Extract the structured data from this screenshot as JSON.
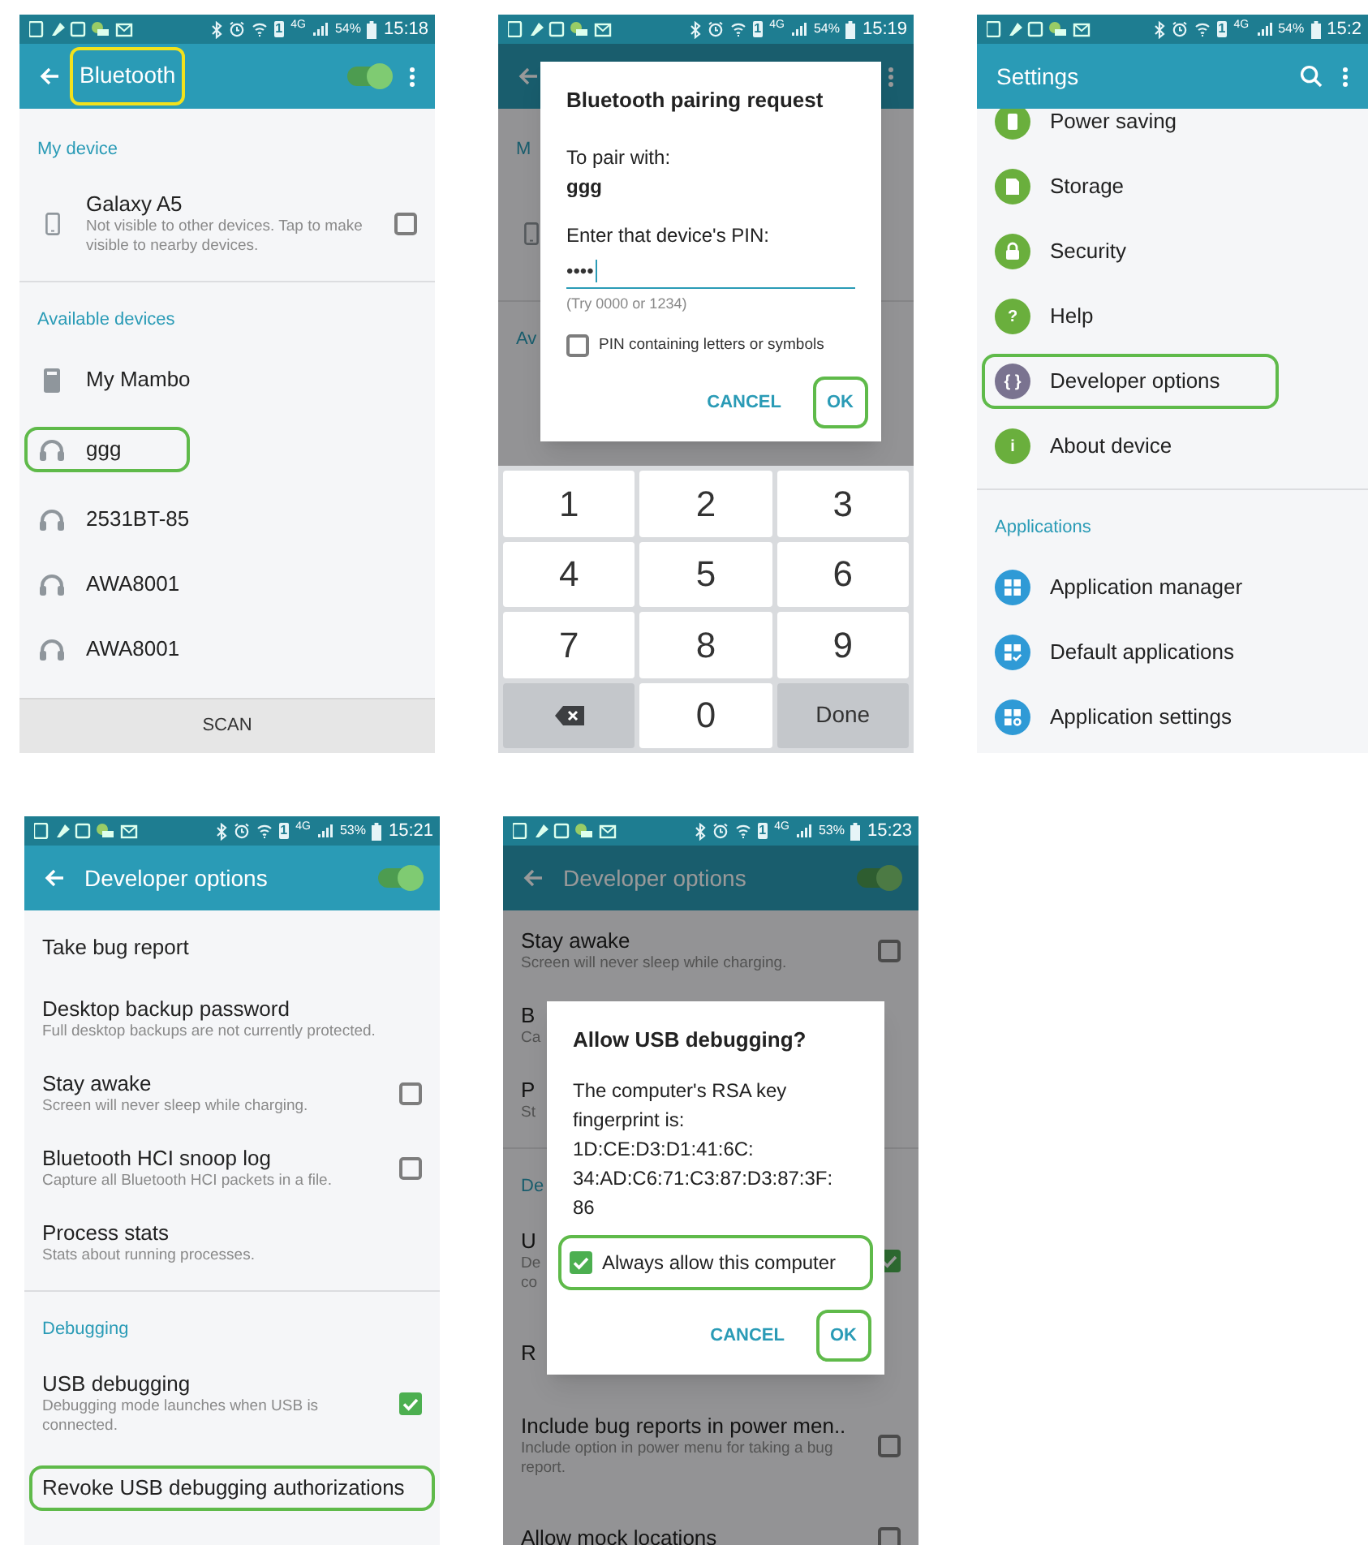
{
  "panels": [
    {
      "kind": "bluetooth",
      "status_bar": {
        "sim": "1",
        "network": "4G",
        "battery": "54%",
        "time": "15:18"
      },
      "app_bar": {
        "back": true,
        "title": "Bluetooth",
        "title_highlighted": true,
        "switch_on": true,
        "menu": true
      },
      "list": [
        {
          "kind": "section",
          "label": "My device"
        },
        {
          "kind": "phone",
          "title": "Galaxy A5",
          "subtitle": "Not visible to other devices. Tap to make visible to nearby devices.",
          "checkbox": {
            "checked": false
          }
        },
        {
          "kind": "divider"
        },
        {
          "kind": "section",
          "label": "Available devices"
        },
        {
          "kind": "speaker",
          "title": "My Mambo"
        },
        {
          "kind": "headset",
          "title": "ggg",
          "highlighted": true
        },
        {
          "kind": "headset",
          "title": "2531BT-85"
        },
        {
          "kind": "headset",
          "title": "AWA8001"
        },
        {
          "kind": "headset",
          "title": "AWA8001"
        }
      ],
      "footer_button": "SCAN"
    },
    {
      "kind": "pairing",
      "status_bar": {
        "sim": "1",
        "network": "4G",
        "battery": "54%",
        "time": "15:19"
      },
      "app_bar": {
        "back": true,
        "menu": true
      },
      "list": [
        {
          "kind": "section",
          "label": "M"
        },
        {
          "kind": "phone"
        },
        {
          "kind": "divider"
        },
        {
          "kind": "section",
          "label": "Av"
        }
      ],
      "dialog": {
        "blocks": [
          {
            "kind": "title",
            "text": "Bluetooth pairing request"
          },
          {
            "kind": "text",
            "text": "To pair with:"
          },
          {
            "kind": "strong",
            "text": "ggg"
          },
          {
            "kind": "text",
            "text": "Enter that device's PIN:"
          },
          {
            "kind": "field",
            "value": "••••"
          },
          {
            "kind": "hint",
            "text": "(Try 0000 or 1234)"
          },
          {
            "kind": "checkbox",
            "label": "PIN containing letters or symbols",
            "checked": false
          }
        ],
        "buttons": [
          {
            "label": "CANCEL"
          },
          {
            "label": "OK",
            "highlighted": true
          }
        ]
      },
      "keypad": [
        {
          "kind": "digit",
          "label": "1"
        },
        {
          "kind": "digit",
          "label": "2"
        },
        {
          "kind": "digit",
          "label": "3"
        },
        {
          "kind": "digit",
          "label": "4"
        },
        {
          "kind": "digit",
          "label": "5"
        },
        {
          "kind": "digit",
          "label": "6"
        },
        {
          "kind": "digit",
          "label": "7"
        },
        {
          "kind": "digit",
          "label": "8"
        },
        {
          "kind": "digit",
          "label": "9"
        },
        {
          "kind": "backspace"
        },
        {
          "kind": "digit",
          "label": "0"
        },
        {
          "kind": "done",
          "label": "Done"
        }
      ]
    },
    {
      "kind": "settings",
      "status_bar": {
        "sim": "1",
        "network": "4G",
        "battery": "54%",
        "time": "15:2"
      },
      "app_bar": {
        "title": "Settings",
        "search": true,
        "menu": true
      },
      "list": [
        {
          "kind": "leaf",
          "title": "Power saving",
          "color": "#6aaf3d"
        },
        {
          "kind": "sdcard",
          "title": "Storage",
          "color": "#6aaf3d"
        },
        {
          "kind": "lock",
          "title": "Security",
          "color": "#6aaf3d"
        },
        {
          "kind": "glyph",
          "glyph": "?",
          "title": "Help",
          "color": "#6aaf3d"
        },
        {
          "kind": "glyph",
          "glyph": "{ }",
          "title": "Developer options",
          "color": "#7a7390",
          "highlighted": true
        },
        {
          "kind": "glyph",
          "glyph": "i",
          "title": "About device",
          "color": "#6aaf3d"
        },
        {
          "kind": "divider"
        },
        {
          "kind": "section",
          "label": "Applications"
        },
        {
          "kind": "grid",
          "title": "Application manager",
          "color": "#2f9ad6"
        },
        {
          "kind": "gridcheck",
          "title": "Default applications",
          "color": "#2f9ad6"
        },
        {
          "kind": "gridgear",
          "title": "Application settings",
          "color": "#2f9ad6"
        }
      ]
    },
    {
      "kind": "developer",
      "status_bar": {
        "sim": "1",
        "network": "4G",
        "battery": "53%",
        "time": "15:21"
      },
      "app_bar": {
        "back": true,
        "title": "Developer options",
        "switch_on": true
      },
      "list": [
        {
          "kind": "plain",
          "title": "Take bug report"
        },
        {
          "kind": "plain",
          "title": "Desktop backup password",
          "subtitle_lines": [
            "Full desktop backups are not currently protected."
          ]
        },
        {
          "kind": "plain",
          "title": "Stay awake",
          "subtitle_lines": [
            "Screen will never sleep while charging."
          ],
          "checkbox": {
            "checked": false
          }
        },
        {
          "kind": "plain",
          "title": "Bluetooth HCI snoop log",
          "subtitle_lines": [
            "Capture all Bluetooth HCI packets in a file."
          ],
          "checkbox": {
            "checked": false
          }
        },
        {
          "kind": "plain",
          "title": "Process stats",
          "subtitle_lines": [
            "Stats about running processes."
          ]
        },
        {
          "kind": "divider"
        },
        {
          "kind": "section",
          "label": "Debugging"
        },
        {
          "kind": "plain",
          "title": "USB debugging",
          "subtitle_lines": [
            "Debugging mode launches when USB is",
            "connected."
          ],
          "checkbox": {
            "checked": true
          }
        },
        {
          "kind": "plain",
          "title": "Revoke USB debugging authorizations",
          "highlighted": true
        }
      ]
    },
    {
      "kind": "usb-dialog",
      "status_bar": {
        "sim": "1",
        "network": "4G",
        "battery": "53%",
        "time": "15:23"
      },
      "app_bar": {
        "back": true,
        "title": "Developer options",
        "switch_on": true
      },
      "list": [
        {
          "kind": "plain",
          "title": "Stay awake",
          "subtitle_lines": [
            "Screen will never sleep while charging."
          ],
          "checkbox": {
            "checked": false
          }
        },
        {
          "kind": "plain",
          "title": "B",
          "subtitle_lines": [
            "Ca"
          ]
        },
        {
          "kind": "plain",
          "title": "P",
          "subtitle_lines": [
            "St"
          ]
        },
        {
          "kind": "divider"
        },
        {
          "kind": "section",
          "label": "De"
        },
        {
          "kind": "plain",
          "title": "U",
          "subtitle_lines": [
            "De",
            "co"
          ],
          "checkbox": {
            "checked": true
          }
        },
        {
          "kind": "plain",
          "title": "R"
        },
        {
          "kind": "plain",
          "title": "Include bug reports in power men..",
          "subtitle_lines": [
            "Include option in power menu for taking a bug",
            "report."
          ],
          "checkbox": {
            "checked": false
          }
        },
        {
          "kind": "plain",
          "title": "Allow mock locations",
          "checkbox": {
            "checked": false
          }
        }
      ],
      "dialog": {
        "blocks": [
          {
            "kind": "title",
            "text": "Allow USB debugging?"
          },
          {
            "kind": "lines",
            "lines": [
              "The computer's RSA key",
              "fingerprint is:",
              "1D:CE:D3:D1:41:6C:",
              "34:AD:C6:71:C3:87:D3:87:3F:",
              "86"
            ]
          },
          {
            "kind": "checkbox",
            "label": "Always allow this computer",
            "checked": true,
            "highlighted": true
          }
        ],
        "buttons": [
          {
            "label": "CANCEL"
          },
          {
            "label": "OK",
            "highlighted": true
          }
        ]
      }
    }
  ]
}
